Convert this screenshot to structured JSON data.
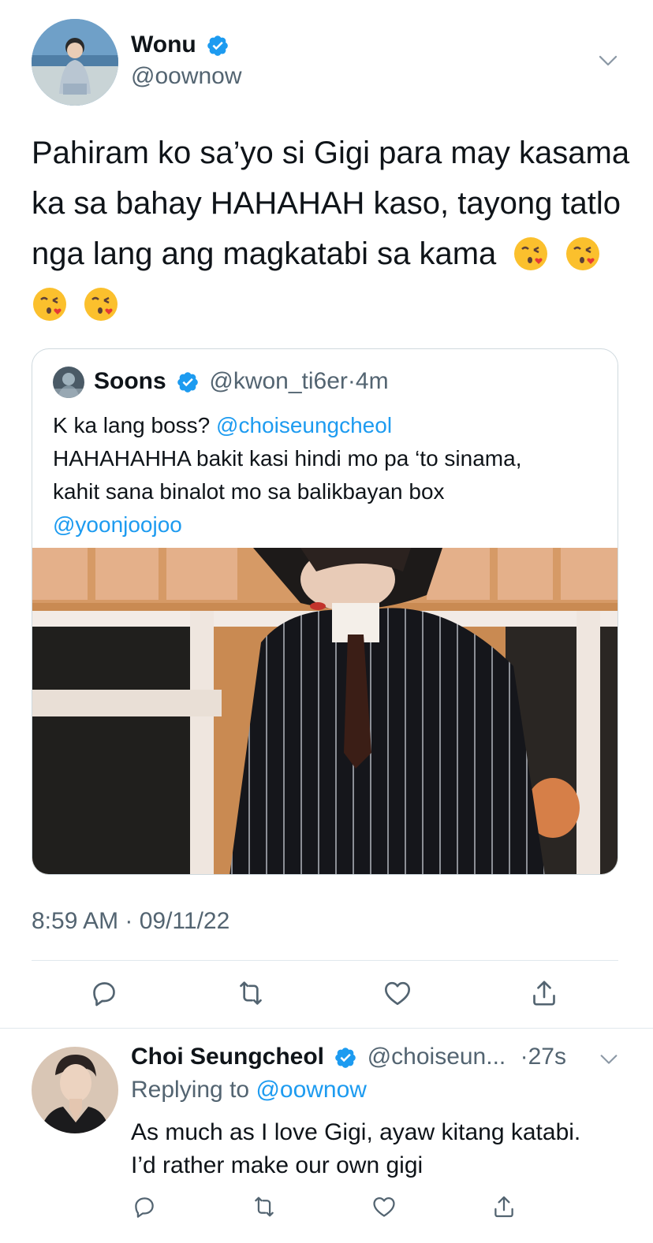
{
  "tweet": {
    "author_name": "Wonu",
    "author_handle": "@oownow",
    "text": "Pahiram ko sa’yo si Gigi para may kasama ka sa bahay HAHAHAH kaso, tayong tatlo nga lang ang magkatabi sa kama",
    "emoji": [
      "face-blowing-a-kiss",
      "face-blowing-a-kiss",
      "face-blowing-a-kiss",
      "face-blowing-a-kiss"
    ],
    "timestamp": "8:59 AM · 09/11/22"
  },
  "quote": {
    "author_name": "Soons",
    "author_handle": "@kwon_ti6er",
    "time": "4m",
    "text_line1_plain": "K ka lang boss? ",
    "mention1": "@choiseungcheol",
    "text_line2": "HAHAHAHHA bakit kasi hindi mo pa ‘to sinama,",
    "text_line3": "kahit sana binalot mo sa balikbayan box",
    "mention2": "@yoonjoojoo"
  },
  "reply": {
    "author_name": "Choi Seungcheol",
    "author_handle": "@choiseun...",
    "time": "27s",
    "replying_label": "Replying to",
    "replying_to": "@oownow",
    "text_line1": "As much as I love Gigi, ayaw kitang katabi.",
    "text_line2": "I’d rather make our own gigi"
  },
  "icons": {
    "more": "chevron-down-icon",
    "reply": "reply-icon",
    "retweet": "retweet-icon",
    "like": "heart-icon",
    "share": "share-icon",
    "verified": "verified-badge-icon"
  },
  "colors": {
    "accent": "#1d9bf0",
    "text": "#0f1419",
    "muted": "#536471",
    "border": "#cfd9de"
  }
}
